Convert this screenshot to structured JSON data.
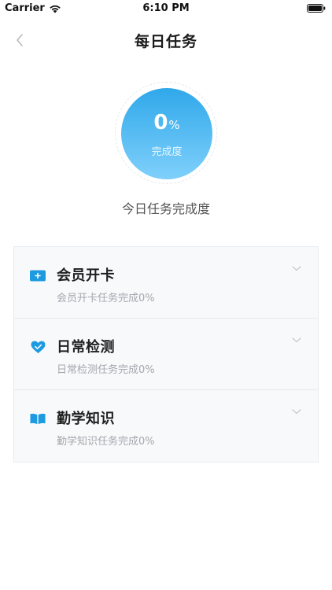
{
  "status_bar": {
    "carrier": "Carrier",
    "time": "6:10 PM"
  },
  "nav": {
    "title": "每日任务",
    "back_icon": "chevron-left-icon"
  },
  "progress": {
    "value": "0",
    "unit": "%",
    "caption": "完成度",
    "fraction": 0,
    "label": "今日任务完成度"
  },
  "colors": {
    "accent": "#30a8ea",
    "accent_light": "#7fd0fb",
    "subtext": "#a3a8ae"
  },
  "tasks": [
    {
      "title": "会员开卡",
      "subtitle": "会员开卡任务完成0%",
      "icon": "card-icon"
    },
    {
      "title": "日常检测",
      "subtitle": "日常检测任务完成0%",
      "icon": "heart-check-icon"
    },
    {
      "title": "勤学知识",
      "subtitle": "勤学知识任务完成0%",
      "icon": "book-icon"
    }
  ]
}
